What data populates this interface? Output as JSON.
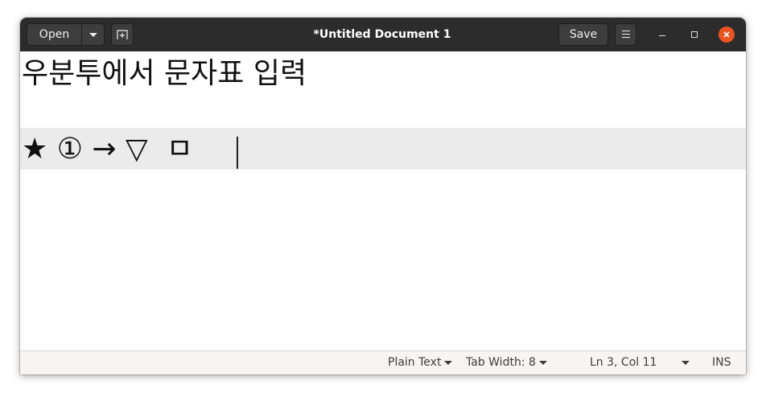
{
  "window": {
    "title": "*Untitled Document 1"
  },
  "headerbar": {
    "open_label": "Open",
    "save_label": "Save",
    "icons": [
      "chevron-down-icon",
      "new-tab-icon",
      "hamburger-menu-icon",
      "minimize-icon",
      "maximize-icon",
      "close-icon"
    ]
  },
  "editor": {
    "lines": [
      "우분투에서 문자표 입력",
      "",
      "★ ① → ▽  ㅁ"
    ],
    "current_line_index": 2
  },
  "statusbar": {
    "language": "Plain Text",
    "tab_width": "Tab Width: 8",
    "position": "Ln 3, Col 11",
    "mode": "INS"
  },
  "colors": {
    "headerbar": "#2c2c2c",
    "close_button": "#e95420",
    "current_line": "#ebebeb",
    "statusbar": "#f6f5f4"
  }
}
